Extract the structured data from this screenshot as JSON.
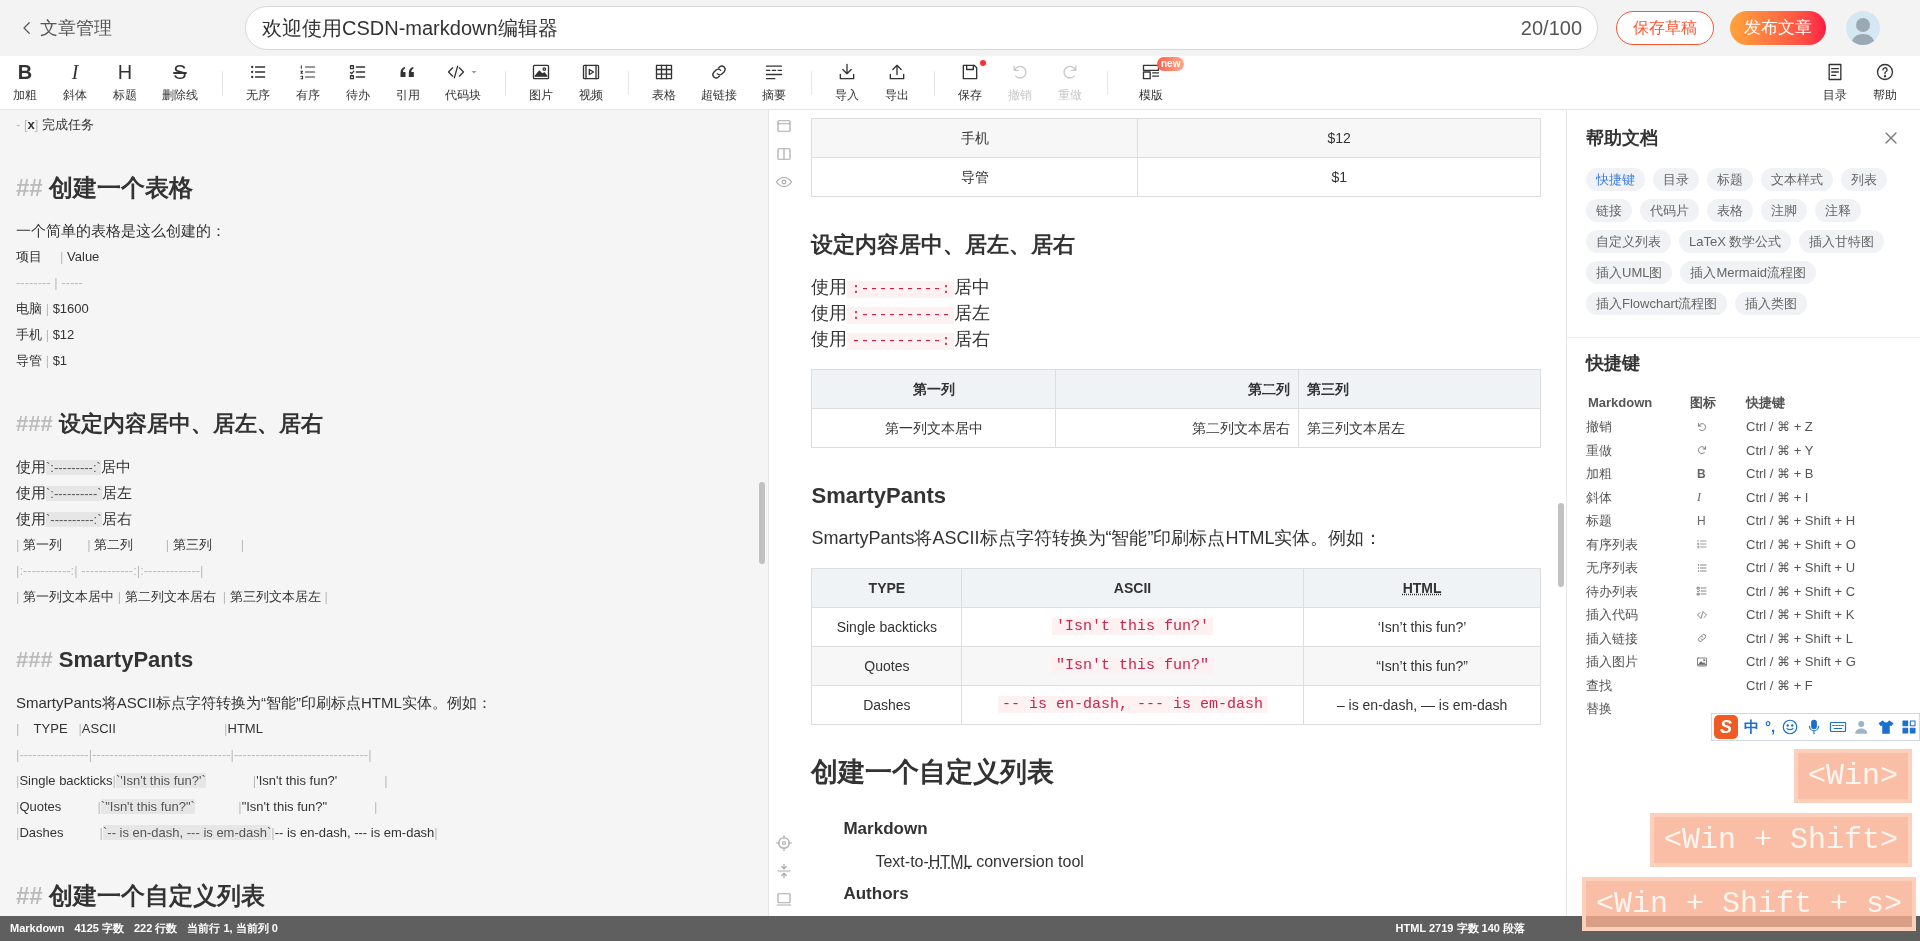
{
  "header": {
    "back_label": "文章管理",
    "title_value": "欢迎使用CSDN-markdown编辑器",
    "counter": "20/100",
    "save_draft": "保存草稿",
    "publish": "发布文章"
  },
  "toolbar": {
    "groups": [
      [
        {
          "kind": "bold",
          "glyph": "B",
          "label": "加粗",
          "disabled": false,
          "dot": false
        },
        {
          "kind": "italic",
          "glyph": "I",
          "label": "斜体",
          "disabled": false,
          "dot": false
        },
        {
          "kind": "heading",
          "glyph": "H",
          "label": "标题",
          "disabled": false,
          "dot": false
        },
        {
          "kind": "strike",
          "glyph": "S",
          "label": "删除线",
          "disabled": false,
          "dot": false
        }
      ],
      [
        {
          "kind": "ul",
          "label": "无序",
          "disabled": false,
          "dot": false
        },
        {
          "kind": "ol",
          "label": "有序",
          "disabled": false,
          "dot": false
        },
        {
          "kind": "todo",
          "label": "待办",
          "disabled": false,
          "dot": false
        },
        {
          "kind": "quote",
          "label": "引用",
          "disabled": false,
          "dot": false
        },
        {
          "kind": "code",
          "label": "代码块",
          "disabled": false,
          "dot": false
        }
      ],
      [
        {
          "kind": "image",
          "label": "图片",
          "disabled": false,
          "dot": false
        },
        {
          "kind": "video",
          "label": "视频",
          "disabled": false,
          "dot": false
        }
      ],
      [
        {
          "kind": "table",
          "label": "表格",
          "disabled": false,
          "dot": false
        },
        {
          "kind": "link",
          "label": "超链接",
          "disabled": false,
          "dot": false
        },
        {
          "kind": "summary",
          "label": "摘要",
          "disabled": false,
          "dot": false
        }
      ],
      [
        {
          "kind": "import",
          "label": "导入",
          "disabled": false,
          "dot": false
        },
        {
          "kind": "export",
          "label": "导出",
          "disabled": false,
          "dot": false
        }
      ],
      [
        {
          "kind": "save",
          "label": "保存",
          "disabled": false,
          "dot": true
        },
        {
          "kind": "undo",
          "label": "撤销",
          "disabled": true,
          "dot": false
        },
        {
          "kind": "redo",
          "label": "重做",
          "disabled": true,
          "dot": false
        }
      ],
      [
        {
          "kind": "template",
          "label": "模版",
          "disabled": false,
          "dot": false,
          "badge": "new"
        }
      ]
    ],
    "right": [
      {
        "kind": "toc",
        "label": "目录",
        "disabled": false,
        "dot": false
      },
      {
        "kind": "help",
        "label": "帮助",
        "disabled": false,
        "dot": false
      }
    ]
  },
  "editor": {
    "lines": [
      {
        "kind": "line",
        "parts": [
          {
            "text": "- [",
            "kind": "syntax"
          },
          {
            "text": "x",
            "kind": "bold"
          },
          {
            "text": "]",
            "kind": "syntax"
          },
          {
            "text": " 完成任务"
          }
        ]
      },
      {
        "kind": "h2",
        "parts": [
          {
            "text": "## ",
            "kind": "syntax"
          },
          {
            "text": "创建一个表格"
          }
        ]
      },
      {
        "kind": "text",
        "parts": [
          {
            "text": "一个简单的表格是这么创建的："
          }
        ]
      },
      {
        "kind": "line",
        "parts": [
          {
            "text": "项目     "
          },
          {
            "text": "| ",
            "kind": "syntax"
          },
          {
            "text": "Value"
          }
        ]
      },
      {
        "kind": "line",
        "parts": [
          {
            "text": "-------- | -----",
            "kind": "syntax"
          }
        ]
      },
      {
        "kind": "line",
        "parts": [
          {
            "text": "电脑 "
          },
          {
            "text": "| ",
            "kind": "syntax"
          },
          {
            "text": "$1600"
          }
        ]
      },
      {
        "kind": "line",
        "parts": [
          {
            "text": "手机 "
          },
          {
            "text": "| ",
            "kind": "syntax"
          },
          {
            "text": "$12"
          }
        ]
      },
      {
        "kind": "line",
        "parts": [
          {
            "text": "导管 "
          },
          {
            "text": "| ",
            "kind": "syntax"
          },
          {
            "text": "$1"
          }
        ]
      },
      {
        "kind": "h3",
        "parts": [
          {
            "text": "### ",
            "kind": "syntax"
          },
          {
            "text": "设定内容居中、居左、居右"
          }
        ]
      },
      {
        "kind": "text",
        "parts": [
          {
            "text": "使用"
          },
          {
            "text": "`:---------:`",
            "kind": "code"
          },
          {
            "text": "居中"
          }
        ]
      },
      {
        "kind": "text",
        "parts": [
          {
            "text": "使用"
          },
          {
            "text": "`:----------`",
            "kind": "code"
          },
          {
            "text": "居左"
          }
        ]
      },
      {
        "kind": "text",
        "parts": [
          {
            "text": "使用"
          },
          {
            "text": "`----------:`",
            "kind": "code"
          },
          {
            "text": "居右"
          }
        ]
      },
      {
        "kind": "line",
        "parts": [
          {
            "text": "| ",
            "kind": "syntax"
          },
          {
            "text": "第一列       "
          },
          {
            "text": "| ",
            "kind": "syntax"
          },
          {
            "text": "第二列         "
          },
          {
            "text": "| ",
            "kind": "syntax"
          },
          {
            "text": "第三列        "
          },
          {
            "text": "|",
            "kind": "syntax"
          }
        ]
      },
      {
        "kind": "line",
        "parts": [
          {
            "text": "|:-----------:| ------------:|:-------------|",
            "kind": "syntax"
          }
        ]
      },
      {
        "kind": "line",
        "parts": [
          {
            "text": "| ",
            "kind": "syntax"
          },
          {
            "text": "第一列文本居中 "
          },
          {
            "text": "| ",
            "kind": "syntax"
          },
          {
            "text": "第二列文本居右  "
          },
          {
            "text": "| ",
            "kind": "syntax"
          },
          {
            "text": "第三列文本居左 "
          },
          {
            "text": "|",
            "kind": "syntax"
          }
        ]
      },
      {
        "kind": "h3",
        "parts": [
          {
            "text": "### ",
            "kind": "syntax"
          },
          {
            "text": "SmartyPants"
          }
        ]
      },
      {
        "kind": "text",
        "parts": [
          {
            "text": "SmartyPants将ASCII标点字符转换为“智能”印刷标点HTML实体。例如："
          }
        ]
      },
      {
        "kind": "line",
        "parts": [
          {
            "text": "|",
            "kind": "syntax"
          },
          {
            "text": "    TYPE   "
          },
          {
            "text": "|",
            "kind": "syntax"
          },
          {
            "text": "ASCII                              "
          },
          {
            "text": "|",
            "kind": "syntax"
          },
          {
            "text": "HTML"
          }
        ]
      },
      {
        "kind": "line",
        "parts": [
          {
            "text": "|----------------|--------------------------------|-------------------------------|",
            "kind": "syntax"
          }
        ]
      },
      {
        "kind": "line",
        "parts": [
          {
            "text": "|",
            "kind": "syntax"
          },
          {
            "text": "Single backticks"
          },
          {
            "text": "|",
            "kind": "syntax"
          },
          {
            "text": "`'Isn't this fun?'`",
            "kind": "code"
          },
          {
            "text": "             |",
            "kind": "syntax"
          },
          {
            "text": "'Isn't this fun?'             "
          },
          {
            "text": "|",
            "kind": "syntax"
          }
        ]
      },
      {
        "kind": "line",
        "parts": [
          {
            "text": "|",
            "kind": "syntax"
          },
          {
            "text": "Quotes          "
          },
          {
            "text": "|",
            "kind": "syntax"
          },
          {
            "text": "`\"Isn't this fun?\"`",
            "kind": "code"
          },
          {
            "text": "            |",
            "kind": "syntax"
          },
          {
            "text": "\"Isn't this fun?\"             "
          },
          {
            "text": "|",
            "kind": "syntax"
          }
        ]
      },
      {
        "kind": "line",
        "parts": [
          {
            "text": "|",
            "kind": "syntax"
          },
          {
            "text": "Dashes          "
          },
          {
            "text": "|",
            "kind": "syntax"
          },
          {
            "text": "`-- is en-dash, --- is em-dash`",
            "kind": "code"
          },
          {
            "text": "|",
            "kind": "syntax"
          },
          {
            "text": "-- is en-dash, --- is em-dash"
          },
          {
            "text": "|",
            "kind": "syntax"
          }
        ]
      },
      {
        "kind": "h2",
        "parts": [
          {
            "text": "## ",
            "kind": "syntax"
          },
          {
            "text": "创建一个自定义列表"
          }
        ]
      }
    ]
  },
  "preview": [
    {
      "kind": "table",
      "rows": [
        [
          [
            {
              "text": "手机"
            }
          ],
          [
            {
              "text": "$12"
            }
          ]
        ],
        [
          [
            {
              "text": "导管"
            }
          ],
          [
            {
              "text": "$1"
            }
          ]
        ]
      ]
    },
    {
      "kind": "h3",
      "parts": [
        {
          "text": "设定内容居中、居左、居右"
        }
      ]
    },
    {
      "kind": "text",
      "parts": [
        {
          "text": "使用"
        },
        {
          "text": ":---------:",
          "kind": "code"
        },
        {
          "text": "居中"
        }
      ]
    },
    {
      "kind": "text",
      "parts": [
        {
          "text": "使用"
        },
        {
          "text": ":----------",
          "kind": "code"
        },
        {
          "text": "居左"
        }
      ]
    },
    {
      "kind": "text",
      "parts": [
        {
          "text": "使用"
        },
        {
          "text": "----------:",
          "kind": "code"
        },
        {
          "text": "居右"
        }
      ]
    },
    {
      "kind": "table",
      "columns": [
        {
          "label": [
            {
              "text": "第一列"
            }
          ]
        },
        {
          "label": [
            {
              "text": "第二列"
            }
          ]
        },
        {
          "label": [
            {
              "text": "第三列"
            }
          ]
        }
      ],
      "rows": [
        [
          [
            {
              "text": "第一列文本居中"
            }
          ],
          [
            {
              "text": "第二列文本居右"
            }
          ],
          [
            {
              "text": "第三列文本居左"
            }
          ]
        ]
      ]
    },
    {
      "kind": "h3",
      "parts": [
        {
          "text": "SmartyPants"
        }
      ]
    },
    {
      "kind": "text",
      "parts": [
        {
          "text": "SmartyPants将ASCII标点字符转换为“智能”印刷标点HTML实体。例如："
        }
      ]
    },
    {
      "kind": "table",
      "columns": [
        {
          "label": [
            {
              "text": "TYPE"
            }
          ]
        },
        {
          "label": [
            {
              "text": "ASCII"
            }
          ]
        },
        {
          "label": [
            {
              "text": "HTML",
              "kind": "abbr"
            }
          ]
        }
      ],
      "rows": [
        [
          [
            {
              "text": "Single backticks"
            }
          ],
          [
            {
              "text": "'Isn't this fun?'",
              "kind": "code"
            }
          ],
          [
            {
              "text": "‘Isn’t this fun?’"
            }
          ]
        ],
        [
          [
            {
              "text": "Quotes"
            }
          ],
          [
            {
              "text": "\"Isn't this fun?\"",
              "kind": "code"
            }
          ],
          [
            {
              "text": "“Isn’t this fun?”"
            }
          ]
        ],
        [
          [
            {
              "text": "Dashes"
            }
          ],
          [
            {
              "text": "-- is en-dash, --- is em-dash",
              "kind": "code"
            }
          ],
          [
            {
              "text": "– is en-dash, — is em-dash"
            }
          ]
        ]
      ]
    },
    {
      "kind": "h2",
      "parts": [
        {
          "text": "创建一个自定义列表"
        }
      ]
    },
    {
      "kind": "dt",
      "parts": [
        {
          "text": "Markdown"
        }
      ]
    },
    {
      "kind": "dd",
      "parts": [
        {
          "text": "Text-to-"
        },
        {
          "text": "HTML",
          "kind": "abbr"
        },
        {
          "text": " conversion tool"
        }
      ]
    },
    {
      "kind": "dt",
      "parts": [
        {
          "text": "Authors"
        }
      ]
    }
  ],
  "help": {
    "title": "帮助文档",
    "tags": [
      {
        "label": "快捷键",
        "selected": true
      },
      {
        "label": "目录",
        "selected": false
      },
      {
        "label": "标题",
        "selected": false
      },
      {
        "label": "文本样式",
        "selected": false
      },
      {
        "label": "列表",
        "selected": false
      },
      {
        "label": "链接",
        "selected": false
      },
      {
        "label": "代码片",
        "selected": false
      },
      {
        "label": "表格",
        "selected": false
      },
      {
        "label": "注脚",
        "selected": false
      },
      {
        "label": "注释",
        "selected": false
      },
      {
        "label": "自定义列表",
        "selected": false
      },
      {
        "label": "LaTeX 数学公式",
        "selected": false
      },
      {
        "label": "插入甘特图",
        "selected": false
      },
      {
        "label": "插入UML图",
        "selected": false
      },
      {
        "label": "插入Mermaid流程图",
        "selected": false
      },
      {
        "label": "插入Flowchart流程图",
        "selected": false
      },
      {
        "label": "插入类图",
        "selected": false
      }
    ],
    "shortcuts_title": "快捷键",
    "columns": [
      "Markdown",
      "图标",
      "快捷键"
    ],
    "rows": [
      {
        "action": "撤销",
        "kind": "undo",
        "keys": "Ctrl / ⌘ + Z"
      },
      {
        "action": "重做",
        "kind": "redo",
        "keys": "Ctrl / ⌘ + Y"
      },
      {
        "action": "加粗",
        "kind": "bold",
        "glyph": "B",
        "keys": "Ctrl / ⌘ + B"
      },
      {
        "action": "斜体",
        "kind": "italic",
        "glyph": "I",
        "keys": "Ctrl / ⌘ + I"
      },
      {
        "action": "标题",
        "kind": "heading",
        "glyph": "H",
        "keys": "Ctrl / ⌘ + Shift + H"
      },
      {
        "action": "有序列表",
        "kind": "ol",
        "keys": "Ctrl / ⌘ + Shift + O"
      },
      {
        "action": "无序列表",
        "kind": "ul",
        "keys": "Ctrl / ⌘ + Shift + U"
      },
      {
        "action": "待办列表",
        "kind": "todo",
        "keys": "Ctrl / ⌘ + Shift + C"
      },
      {
        "action": "插入代码",
        "kind": "code",
        "keys": "Ctrl / ⌘ + Shift + K"
      },
      {
        "action": "插入链接",
        "kind": "link",
        "keys": "Ctrl / ⌘ + Shift + L"
      },
      {
        "action": "插入图片",
        "kind": "image",
        "keys": "Ctrl / ⌘ + Shift + G"
      },
      {
        "action": "查找",
        "kind": "none",
        "keys": "Ctrl / ⌘ + F"
      },
      {
        "action": "替换",
        "kind": "none"
      }
    ]
  },
  "status_bar": {
    "left": [
      "Markdown",
      "4125 字数",
      "222 行数",
      "当前行 1, 当前列 0"
    ],
    "right": "HTML 2719 字数 140 段落"
  },
  "ime_bar": {
    "logo": "S",
    "labels": [
      "中",
      "°,"
    ]
  },
  "key_overlays": [
    "<Win>",
    "<Win + Shift>",
    "<Win + Shift + s>"
  ]
}
